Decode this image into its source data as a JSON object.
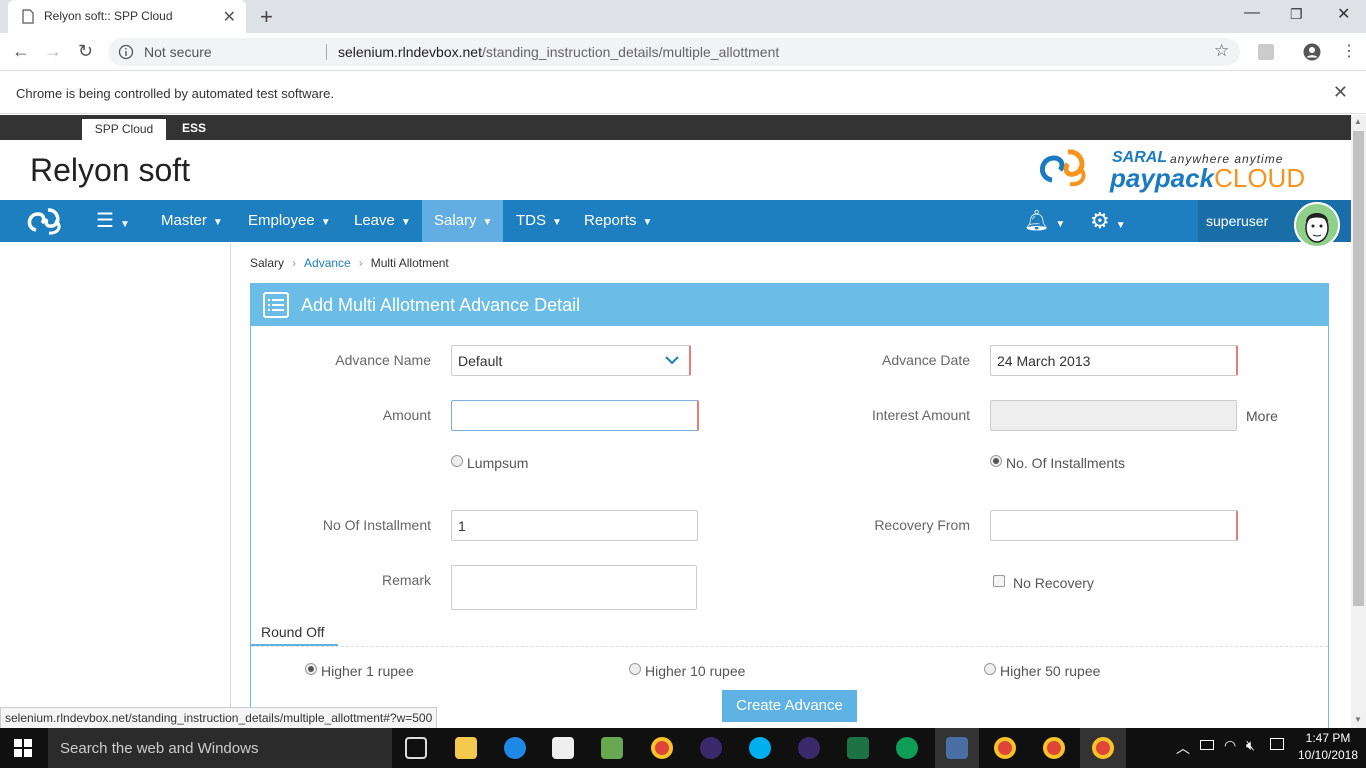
{
  "browser": {
    "tab_title": "Relyon soft:: SPP Cloud",
    "new_tab": "+",
    "not_secure": "Not secure",
    "url_host": "selenium.rlndevbox.net",
    "url_path": "/standing_instruction_details/multiple_allottment",
    "infobar": "Chrome is being controlled by automated test software.",
    "status_url": "selenium.rlndevbox.net/standing_instruction_details/multiple_allottment#?w=500"
  },
  "app": {
    "tabs": [
      "SPP Cloud",
      "ESS"
    ],
    "brand": "Relyon soft",
    "logo": {
      "saral": "SARAL",
      "tagline": "anywhere anytime",
      "pay": "paypack",
      "cloud": "CLOUD"
    },
    "nav": [
      "Master",
      "Employee",
      "Leave",
      "Salary",
      "TDS",
      "Reports"
    ],
    "active_nav": "Salary",
    "user": "superuser"
  },
  "breadcrumb": [
    "Salary",
    "Advance",
    "Multi Allotment"
  ],
  "form": {
    "title": "Add Multi Allotment Advance Detail",
    "advance_name_label": "Advance Name",
    "advance_name_value": "Default",
    "advance_date_label": "Advance Date",
    "advance_date_value": "24 March 2013",
    "amount_label": "Amount",
    "amount_value": "",
    "interest_label": "Interest Amount",
    "interest_value": "",
    "more": "More",
    "lumpsum": "Lumpsum",
    "installments_option": "No. Of Installments",
    "no_installment_label": "No Of Installment",
    "no_installment_value": "1",
    "recovery_from_label": "Recovery From",
    "recovery_from_value": "",
    "remark_label": "Remark",
    "remark_value": "",
    "no_recovery": "No Recovery",
    "round_off_tab": "Round Off",
    "round_options": [
      "Higher 1 rupee",
      "Higher 10 rupee",
      "Higher 50 rupee"
    ],
    "create_button": "Create Advance"
  },
  "taskbar": {
    "search": "Search the web and Windows",
    "time": "1:47 PM",
    "date": "10/10/2018"
  }
}
